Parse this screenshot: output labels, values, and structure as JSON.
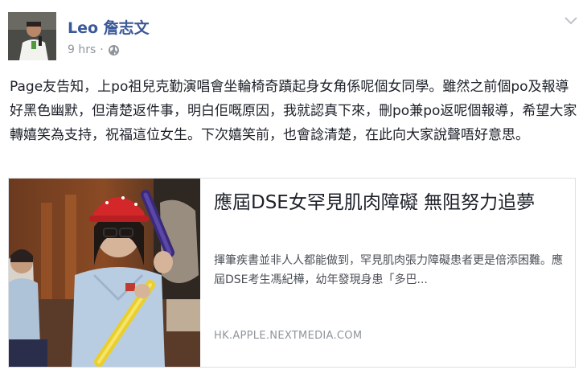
{
  "post": {
    "author": "Leo 詹志文",
    "time": "9 hrs",
    "separator": "·",
    "privacy_icon": "globe-icon",
    "menu_icon": "chevron-down-icon",
    "text": "Page友告知，上po祖兒克勤演唱會坐輪椅奇蹟起身女角係呢個女同學。雖然之前個po及報導好黑色幽默，但清楚返件事，明白佢嘅原因，我就認真下來，刪po兼po返呢個報導，希望大家轉嬉笑為支持，祝福這位女生。下次嬉笑前，也會諗清楚，在此向大家說聲唔好意思。"
  },
  "link": {
    "title": "應屆DSE女罕見肌肉障礙 無阻努力追夢",
    "description": "揮筆疾書並非人人都能做到，罕見肌肉張力障礙患者更是倍添困難。應屆DSE考生馮紀樺，幼年發現身患「多巴...",
    "domain": "HK.APPLE.NEXTMEDIA.COM"
  },
  "colors": {
    "author_link": "#3b5998",
    "meta_gray": "#90949c",
    "text": "#1d2129",
    "card_border": "#dddfe2"
  }
}
